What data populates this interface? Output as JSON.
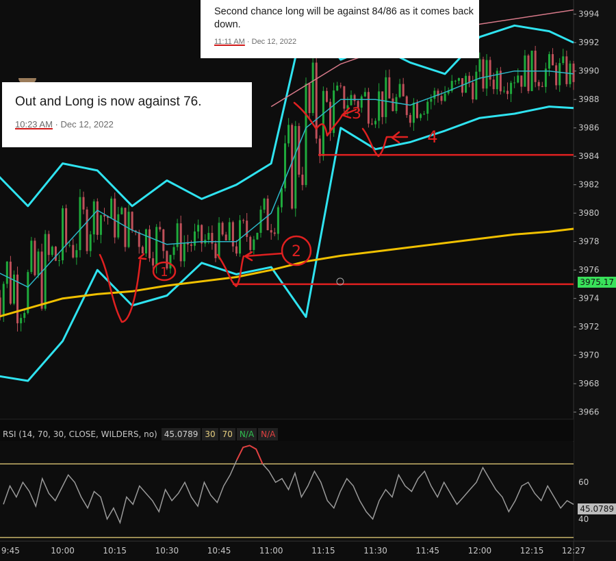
{
  "colors": {
    "background": "#0d0d0d",
    "candle_up": "#1faa3c",
    "candle_down": "#c0505a",
    "band": "#2fe3f0",
    "band_mid": "#2bb8c8",
    "ema": "#f0c000",
    "upper_pink": "#d87a8a",
    "annotation": "#e02020",
    "rsi_line": "#9a9a9a",
    "rsi_level": "#c9b46a"
  },
  "price_axis": {
    "ticks": [
      "3994",
      "3992",
      "3990",
      "3988",
      "3986",
      "3984",
      "3982",
      "3980",
      "3978",
      "3976",
      "3974",
      "3972",
      "3970",
      "3968",
      "3966"
    ],
    "current_label": "3975.17"
  },
  "time_axis": {
    "ticks": [
      "9:45",
      "10:00",
      "10:15",
      "10:30",
      "10:45",
      "11:00",
      "11:15",
      "11:30",
      "11:45",
      "12:00",
      "12:15",
      "12:27"
    ]
  },
  "rsi": {
    "label": "RSI (14, 70, 30, CLOSE, WILDERS, no)",
    "value": "45.0789",
    "upper": "30",
    "lower": "70",
    "na1": "N/A",
    "na2": "N/A",
    "ticks": [
      "60",
      "40"
    ],
    "current": "45.0789"
  },
  "notes": {
    "first": {
      "text": "Out and Long is now against 76.",
      "time": "10:23 AM",
      "date": " · Dec 12, 2022"
    },
    "second": {
      "text": "Second chance long will be against 84/86 as it comes back down.",
      "time": "11:11 AM",
      "date": " · Dec 12, 2022"
    }
  },
  "annotation_labels": [
    "1",
    "2",
    "3",
    "4"
  ],
  "chart_data": {
    "type": "line",
    "title": "",
    "x_range": [
      "9:40",
      "12:27"
    ],
    "ylim": [
      3965.5,
      3995
    ],
    "horizontal_levels": [
      3984.1,
      3975.0
    ],
    "series": [
      {
        "values_desc": "upper_band",
        "x": [
          "9:40",
          "9:50",
          "10:00",
          "10:10",
          "10:20",
          "10:30",
          "10:40",
          "10:50",
          "11:00",
          "11:10",
          "11:20",
          "11:30",
          "11:40",
          "11:50",
          "12:00",
          "12:10",
          "12:20",
          "12:27"
        ],
        "values": [
          3983.0,
          3980.5,
          3983.5,
          3983.0,
          3980.5,
          3982.3,
          3981.0,
          3982.0,
          3983.5,
          3994.2,
          3990.8,
          3991.8,
          3990.6,
          3989.8,
          3992.4,
          3993.2,
          3992.8,
          3992.0
        ]
      },
      {
        "values_desc": "lower_band",
        "x": [
          "9:40",
          "9:50",
          "10:00",
          "10:10",
          "10:20",
          "10:30",
          "10:40",
          "10:50",
          "11:00",
          "11:10",
          "11:20",
          "11:30",
          "11:40",
          "11:50",
          "12:00",
          "12:10",
          "12:20",
          "12:27"
        ],
        "values": [
          3968.6,
          3968.2,
          3971.0,
          3976.0,
          3973.5,
          3974.2,
          3976.5,
          3975.7,
          3976.2,
          3972.7,
          3986.0,
          3984.5,
          3985.0,
          3985.8,
          3986.7,
          3987.0,
          3987.5,
          3987.4
        ]
      },
      {
        "values_desc": "middle_band",
        "x": [
          "9:40",
          "9:50",
          "10:00",
          "10:10",
          "10:20",
          "10:30",
          "10:40",
          "10:50",
          "11:00",
          "11:10",
          "11:20",
          "11:30",
          "11:40",
          "11:50",
          "12:00",
          "12:10",
          "12:20",
          "12:27"
        ],
        "values": [
          3976.0,
          3974.8,
          3977.5,
          3980.2,
          3978.8,
          3977.8,
          3978.0,
          3978.0,
          3980.0,
          3986.0,
          3988.0,
          3988.0,
          3987.6,
          3988.5,
          3989.5,
          3990.0,
          3990.0,
          3989.8
        ]
      },
      {
        "values_desc": "ema",
        "x": [
          "9:40",
          "9:50",
          "10:00",
          "10:10",
          "10:20",
          "10:30",
          "10:40",
          "10:50",
          "11:00",
          "11:10",
          "11:20",
          "11:30",
          "11:40",
          "11:50",
          "12:00",
          "12:10",
          "12:20",
          "12:27"
        ],
        "values": [
          3972.6,
          3973.3,
          3974.0,
          3974.3,
          3974.5,
          3974.9,
          3975.2,
          3975.5,
          3976.0,
          3976.6,
          3977.0,
          3977.3,
          3977.6,
          3977.9,
          3978.2,
          3978.5,
          3978.7,
          3978.9
        ]
      }
    ],
    "rsi_series": {
      "ylim": [
        28,
        82
      ],
      "levels": [
        70,
        30
      ],
      "values": [
        48,
        58,
        52,
        60,
        55,
        47,
        62,
        54,
        50,
        57,
        64,
        60,
        52,
        46,
        55,
        52,
        40,
        46,
        38,
        52,
        48,
        58,
        54,
        50,
        44,
        56,
        50,
        54,
        60,
        52,
        47,
        60,
        53,
        49,
        58,
        64,
        72,
        79,
        80,
        78,
        70,
        66,
        60,
        62,
        56,
        65,
        52,
        58,
        66,
        60,
        50,
        46,
        55,
        62,
        58,
        50,
        44,
        40,
        50,
        56,
        52,
        64,
        58,
        55,
        62,
        66,
        58,
        52,
        60,
        54,
        48,
        52,
        56,
        60,
        68,
        62,
        56,
        52,
        44,
        50,
        58,
        60,
        54,
        50,
        58,
        52,
        46,
        50,
        48
      ]
    }
  }
}
